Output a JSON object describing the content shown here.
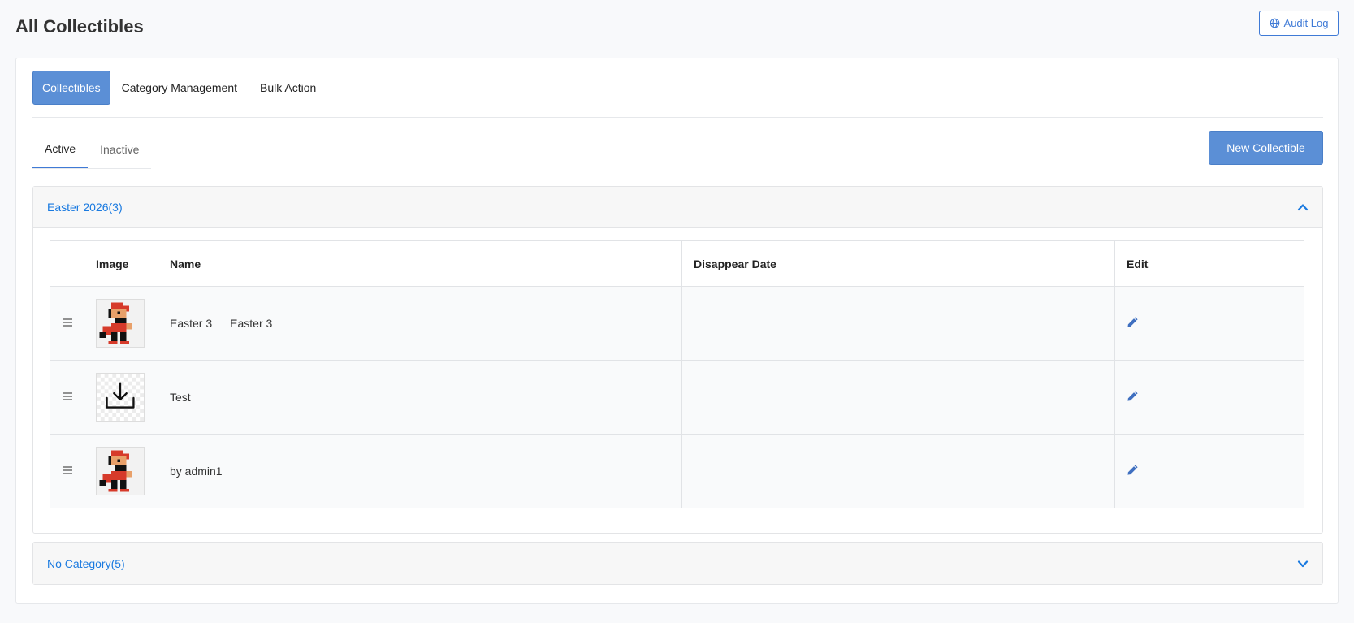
{
  "header": {
    "title": "All Collectibles",
    "audit_label": "Audit Log"
  },
  "main_tabs": [
    {
      "label": "Collectibles",
      "active": true
    },
    {
      "label": "Category Management",
      "active": false
    },
    {
      "label": "Bulk Action",
      "active": false
    }
  ],
  "sub_tabs": [
    {
      "label": "Active",
      "active": true
    },
    {
      "label": "Inactive",
      "active": false
    }
  ],
  "new_button": "New Collectible",
  "categories": [
    {
      "title": "Easter 2026(3)",
      "expanded": true,
      "columns": [
        "",
        "Image",
        "Name",
        "Disappear Date",
        "Edit"
      ],
      "rows": [
        {
          "image": "pixel-raccoon-character",
          "name": "Easter 3",
          "name_extra": "Easter 3",
          "disappear": ""
        },
        {
          "image": "upload-placeholder-icon",
          "name": "Test",
          "name_extra": "",
          "disappear": ""
        },
        {
          "image": "pixel-raccoon-character",
          "name": "by admin1",
          "name_extra": "",
          "disappear": ""
        }
      ]
    },
    {
      "title": "No Category(5)",
      "expanded": false
    }
  ],
  "colors": {
    "primary": "#5b8fd6",
    "link": "#1a7ae0",
    "border": "#e3e4e6"
  }
}
